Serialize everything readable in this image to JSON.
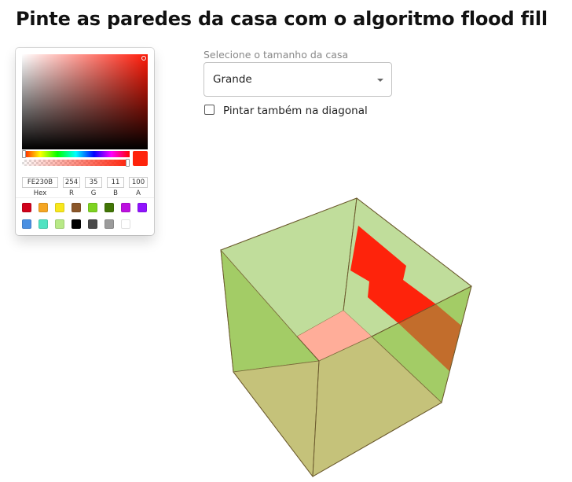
{
  "title": "Pinte as paredes da casa com o algoritmo flood fill",
  "color_picker": {
    "hex": "FE230B",
    "r": "254",
    "g": "35",
    "b": "11",
    "a": "100",
    "labels": {
      "hex": "Hex",
      "r": "R",
      "g": "G",
      "b": "B",
      "a": "A"
    },
    "current_color": "#fe230b",
    "presets": [
      "#d0021b",
      "#f5a623",
      "#f8e71c",
      "#8b572a",
      "#7ed321",
      "#417505",
      "#bd10e0",
      "#9013fe",
      "#4a90e2",
      "#50e3c2",
      "#b8e986",
      "#000000",
      "#4a4a4a",
      "#9b9b9b",
      "#ffffff"
    ]
  },
  "house_size": {
    "label": "Selecione o tamanho da casa",
    "value": "Grande"
  },
  "diagonal": {
    "label": "Pintar também na diagonal",
    "checked": false
  },
  "house": {
    "wall_color": "#c0dd9b",
    "side_wall_color": "#a3cc66",
    "floor_color": "#c5c27a",
    "floor_tile_color": "#ffad99",
    "painted_color": "#fe230b",
    "painted_shaded_color": "#c26d2c"
  }
}
